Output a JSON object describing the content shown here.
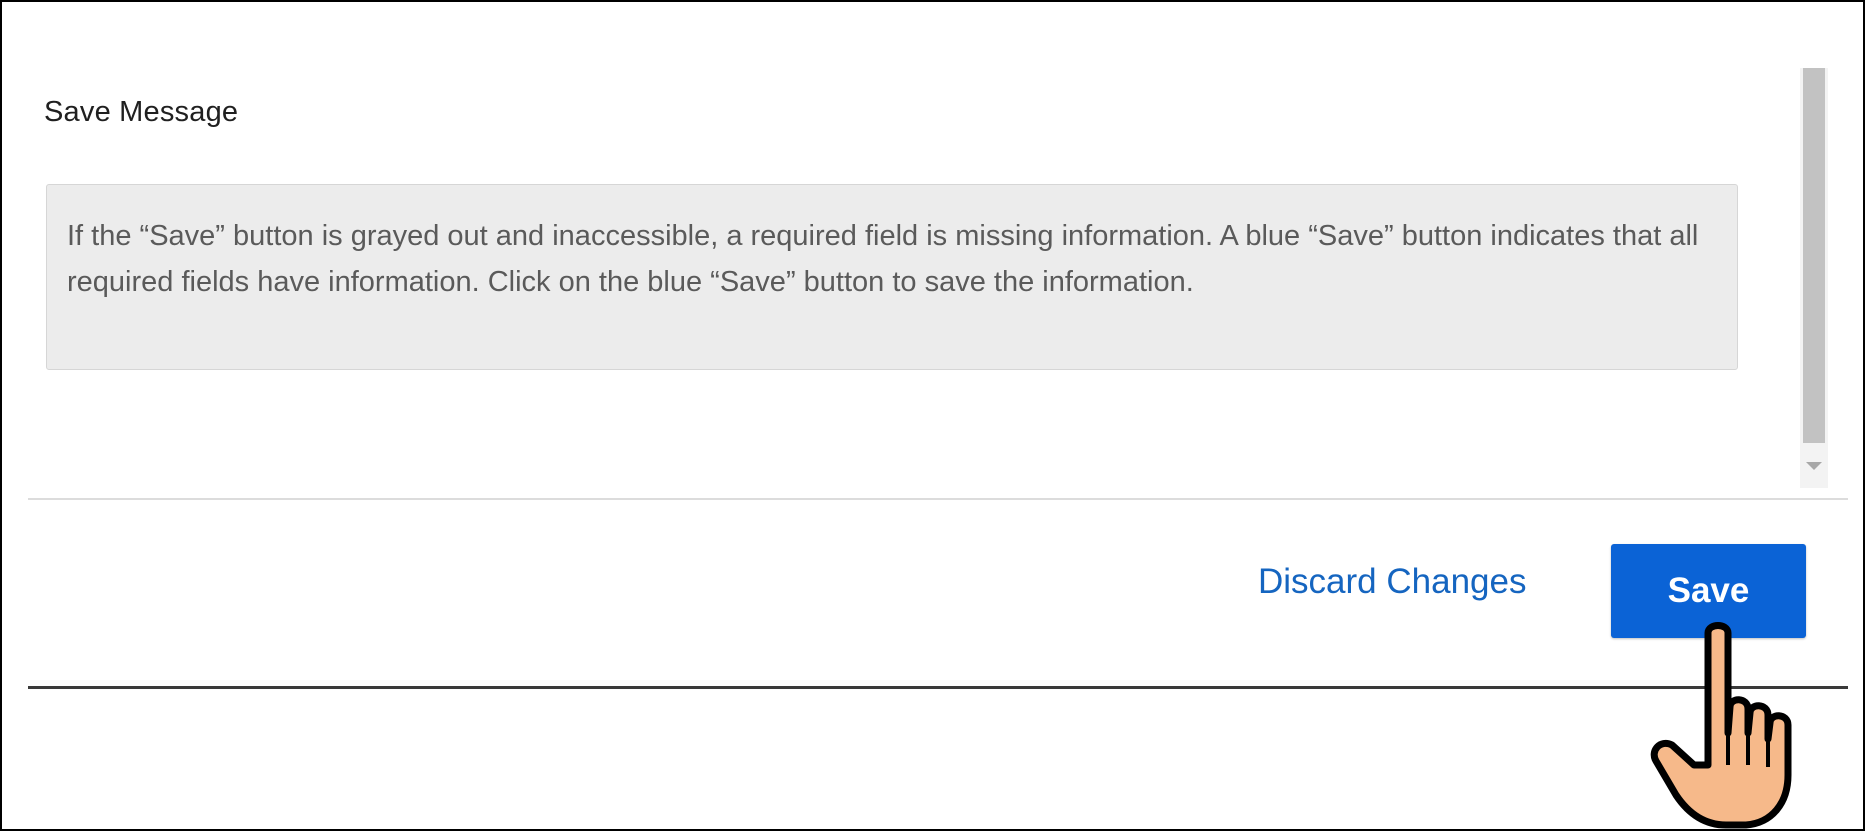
{
  "dialog": {
    "title": "Save Message",
    "message": "If the “Save” button is grayed out and inaccessible, a required field is missing information.  A blue “Save” button indicates that all required fields have information.  Click on the blue “Save” button to save the information."
  },
  "footer": {
    "discard_label": "Discard Changes",
    "save_label": "Save"
  },
  "icons": {
    "cursor": "pointing-hand-icon",
    "scroll_down": "scroll-down-arrow-icon"
  },
  "colors": {
    "save_button": "#0b63d6",
    "link": "#1565c0",
    "message_background": "#ececec",
    "hand_fill": "#f6b98a"
  }
}
